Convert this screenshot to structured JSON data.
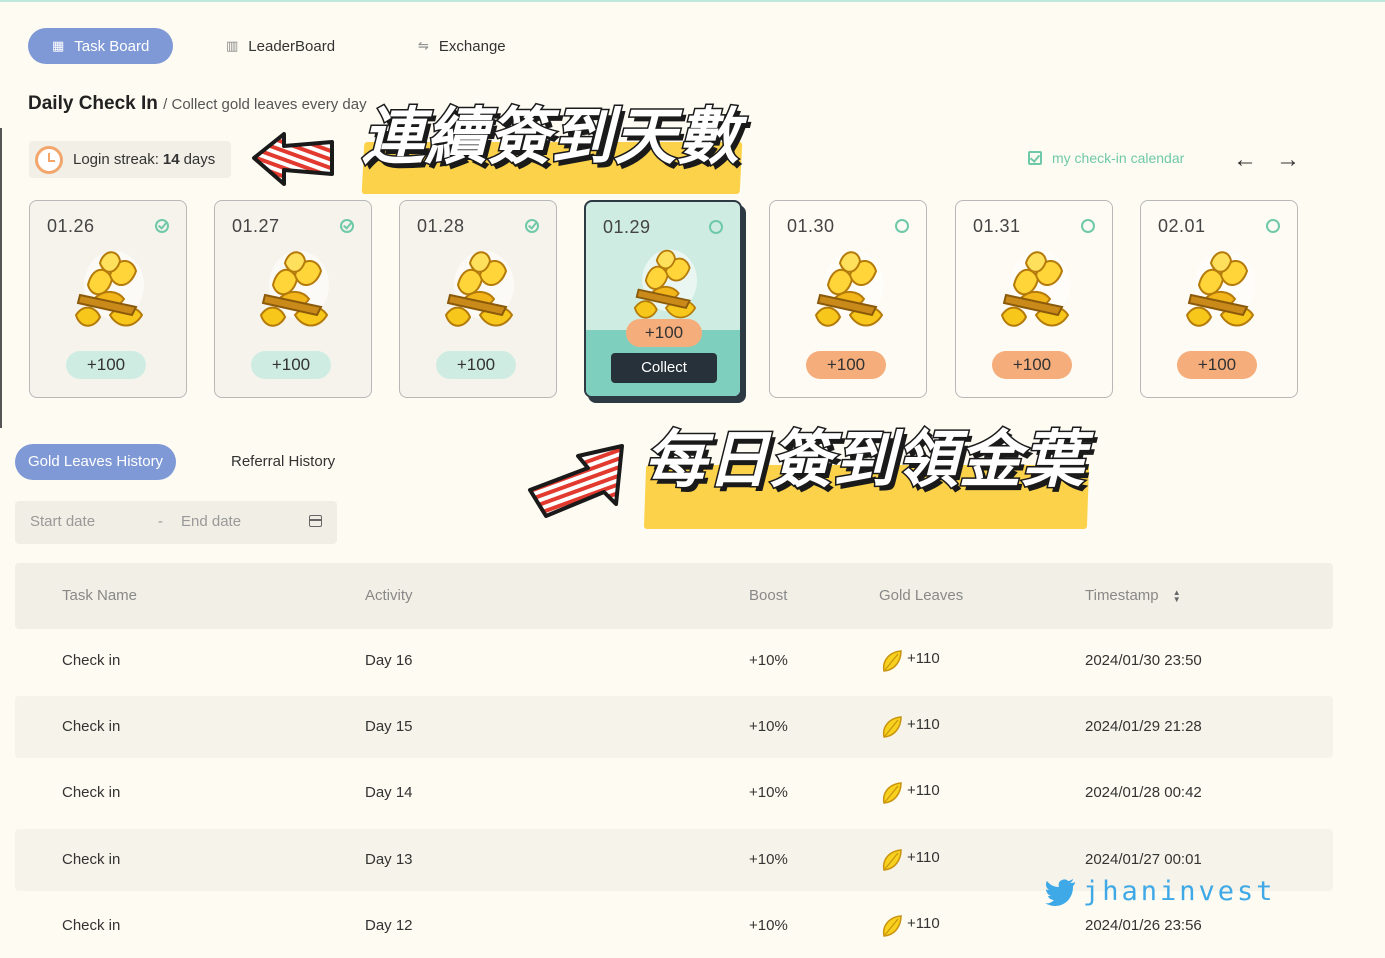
{
  "nav": {
    "tabs": [
      {
        "label": "Task Board",
        "icon": "grid-icon",
        "active": true
      },
      {
        "label": "LeaderBoard",
        "icon": "bar-chart-icon",
        "active": false
      },
      {
        "label": "Exchange",
        "icon": "exchange-icon",
        "active": false
      }
    ]
  },
  "checkin": {
    "title": "Daily Check In",
    "subtitle": "/ Collect gold leaves every day",
    "streak_label": "Login streak:",
    "streak_value": "14",
    "streak_unit": "days",
    "calendar_link": "my check-in calendar",
    "prev_arrow": "←",
    "next_arrow": "→",
    "days": [
      {
        "date": "01.26",
        "reward": "+100",
        "state": "done"
      },
      {
        "date": "01.27",
        "reward": "+100",
        "state": "done"
      },
      {
        "date": "01.28",
        "reward": "+100",
        "state": "done"
      },
      {
        "date": "01.29",
        "reward": "+100",
        "state": "today"
      },
      {
        "date": "01.30",
        "reward": "+100",
        "state": "future"
      },
      {
        "date": "01.31",
        "reward": "+100",
        "state": "future"
      },
      {
        "date": "02.01",
        "reward": "+100",
        "state": "future"
      }
    ],
    "collect_label": "Collect"
  },
  "history": {
    "tabs": [
      "Gold Leaves History",
      "Referral History"
    ],
    "start_placeholder": "Start date",
    "range_sep": "-",
    "end_placeholder": "End date",
    "columns": [
      "Task Name",
      "Activity",
      "Boost",
      "Gold Leaves",
      "Timestamp"
    ],
    "rows": [
      {
        "task": "Check in",
        "activity": "Day 16",
        "boost": "+10%",
        "leaves": "+110",
        "timestamp": "2024/01/30 23:50"
      },
      {
        "task": "Check in",
        "activity": "Day 15",
        "boost": "+10%",
        "leaves": "+110",
        "timestamp": "2024/01/29 21:28"
      },
      {
        "task": "Check in",
        "activity": "Day 14",
        "boost": "+10%",
        "leaves": "+110",
        "timestamp": "2024/01/28 00:42"
      },
      {
        "task": "Check in",
        "activity": "Day 13",
        "boost": "+10%",
        "leaves": "+110",
        "timestamp": "2024/01/27 00:01"
      },
      {
        "task": "Check in",
        "activity": "Day 12",
        "boost": "+10%",
        "leaves": "+110",
        "timestamp": "2024/01/26 23:56"
      }
    ]
  },
  "overlays": {
    "top_caption": "連續簽到天數",
    "bottom_caption": "每日簽到領金葉",
    "watermark": "jhaninvest"
  },
  "colors": {
    "accent_blue": "#7f99d6",
    "mint": "#6fc9a8",
    "orange_pill": "#f5ad7b",
    "highlight_yellow": "#fbd24a",
    "background": "#fdfbf2"
  }
}
